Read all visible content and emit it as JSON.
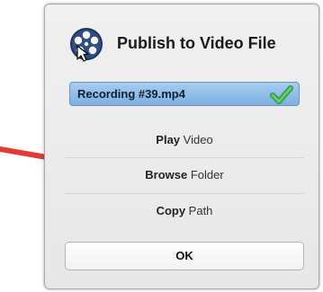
{
  "dialog": {
    "title": "Publish to Video File",
    "app_icon": "film-reel-icon",
    "file": {
      "name": "Recording #39.mp4",
      "status_icon": "green-check-icon"
    },
    "actions": [
      {
        "bold": "Play",
        "rest": " Video"
      },
      {
        "bold": "Browse",
        "rest": " Folder"
      },
      {
        "bold": "Copy",
        "rest": " Path"
      }
    ],
    "ok_label": "OK"
  },
  "annotation": {
    "icon": "red-arrow-icon",
    "color": "#e53935"
  },
  "colors": {
    "file_bar": "#8fbce8",
    "check": "#3bb54a"
  }
}
